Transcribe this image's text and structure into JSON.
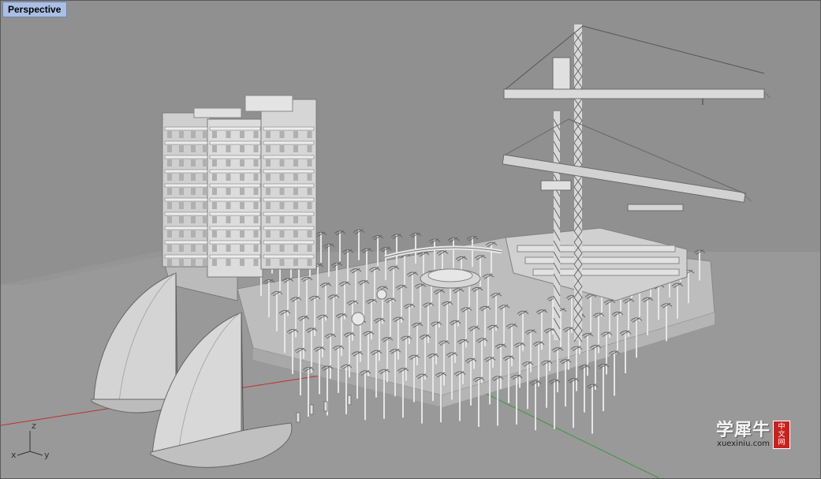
{
  "viewport": {
    "title": "Perspective"
  },
  "axes": {
    "z": "z",
    "x": "x",
    "y": "y"
  },
  "watermark": {
    "main": "学犀牛",
    "url": "xuexiniu.com",
    "seal": [
      "中",
      "文",
      "网"
    ]
  },
  "colors": {
    "background": "#909090",
    "ground": "#999999",
    "model": "#d9d9d9",
    "x_axis": "#c03030",
    "y_axis": "#3c9a3c",
    "tab": "#a9bfe3"
  }
}
